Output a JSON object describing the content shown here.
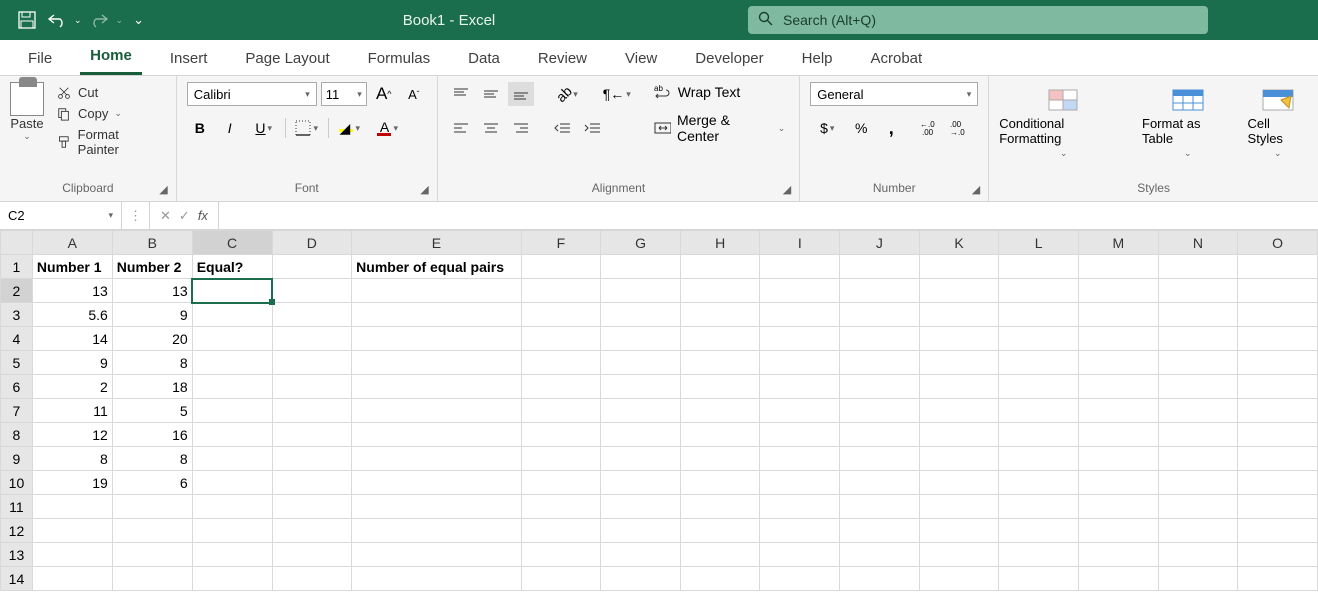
{
  "title": "Book1 - Excel",
  "search": {
    "placeholder": "Search (Alt+Q)"
  },
  "tabs": [
    "File",
    "Home",
    "Insert",
    "Page Layout",
    "Formulas",
    "Data",
    "Review",
    "View",
    "Developer",
    "Help",
    "Acrobat"
  ],
  "active_tab": "Home",
  "ribbon": {
    "clipboard": {
      "paste": "Paste",
      "cut": "Cut",
      "copy": "Copy",
      "fmt": "Format Painter",
      "label": "Clipboard"
    },
    "font": {
      "name": "Calibri",
      "size": "11",
      "label": "Font"
    },
    "alignment": {
      "wrap": "Wrap Text",
      "merge": "Merge & Center",
      "label": "Alignment"
    },
    "number": {
      "format": "General",
      "label": "Number"
    },
    "styles": {
      "cond": "Conditional Formatting",
      "table": "Format as Table",
      "cell": "Cell Styles",
      "label": "Styles"
    }
  },
  "glyphs": {
    "bold": "B",
    "italic": "I",
    "underline": "U",
    "incA": "A",
    "decA": "A",
    "fx": "fx",
    "dollar": "$",
    "pct": "%",
    "comma": ",",
    "inc0": ".00",
    "dec0": ".0",
    "caret": "▾",
    "check": "✓",
    "x": "✕",
    "dots": "⋮",
    "redo": "↻",
    "undo": "↺",
    "save": "💾",
    "qcaret": "⌄",
    "search": "🔍"
  },
  "namebox": "C2",
  "formula": "",
  "cols": [
    "A",
    "B",
    "C",
    "D",
    "E",
    "F",
    "G",
    "H",
    "I",
    "J",
    "K",
    "L",
    "M",
    "N",
    "O"
  ],
  "headers": {
    "A": "Number 1",
    "B": "Number 2",
    "C": "Equal?",
    "E": "Number of equal pairs"
  },
  "rows": [
    {
      "A": "13",
      "B": "13"
    },
    {
      "A": "5.6",
      "B": "9"
    },
    {
      "A": "14",
      "B": "20"
    },
    {
      "A": "9",
      "B": "8"
    },
    {
      "A": "2",
      "B": "18"
    },
    {
      "A": "11",
      "B": "5"
    },
    {
      "A": "12",
      "B": "16"
    },
    {
      "A": "8",
      "B": "8"
    },
    {
      "A": "19",
      "B": "6"
    }
  ],
  "row_count": 14,
  "selected": {
    "col": "C",
    "row": 2
  }
}
